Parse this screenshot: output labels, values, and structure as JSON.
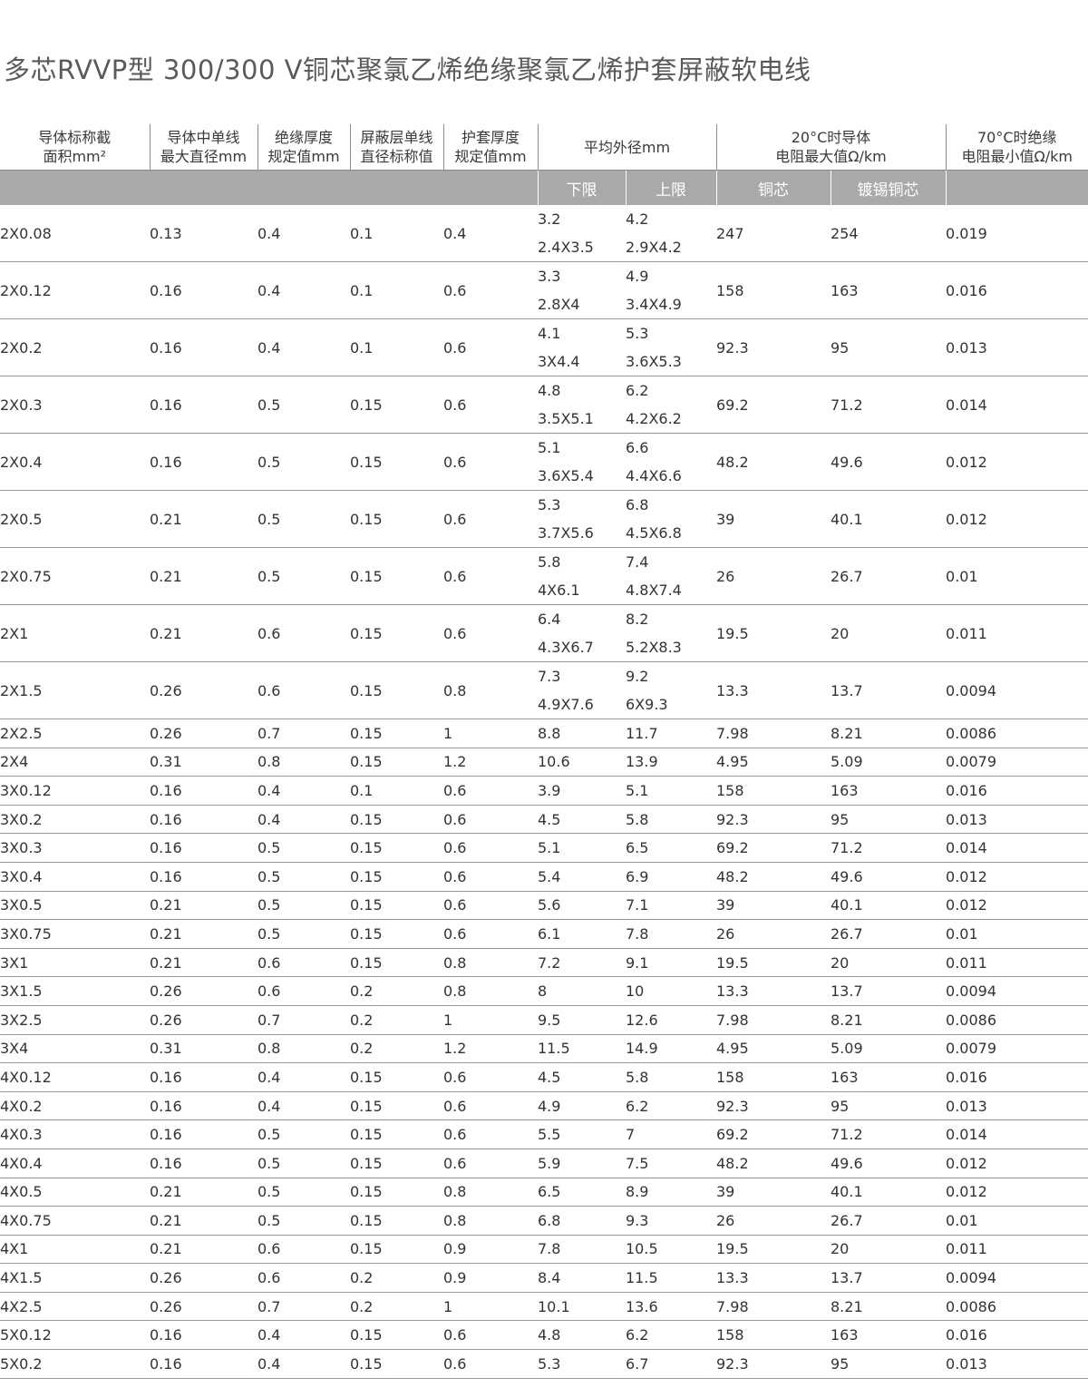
{
  "title": "多芯RVVP型 300/300 V铜芯聚氯乙烯绝缘聚氯乙烯护套屏蔽软电线",
  "headers": {
    "area_l1": "导体标称截",
    "area_l2": "面积mm²",
    "wire_l1": "导体中单线",
    "wire_l2": "最大直径mm",
    "insul_l1": "绝缘厚度",
    "insul_l2": "规定值mm",
    "shield_l1": "屏蔽层单线",
    "shield_l2": "直径标称值",
    "sheath_l1": "护套厚度",
    "sheath_l2": "规定值mm",
    "od": "平均外径mm",
    "res20_l1": "20°C时导体",
    "res20_l2": "电阻最大值Ω/km",
    "ins70_l1": "70°C时绝缘",
    "ins70_l2": "电阻最小值Ω/km",
    "lower": "下限",
    "upper": "上限",
    "copper": "铜芯",
    "tinned": "镀锡铜芯"
  },
  "rows": [
    {
      "area": "2X0.08",
      "wire": "0.13",
      "ins": "0.4",
      "shield": "0.1",
      "sheath": "0.4",
      "lo1": "3.2",
      "lo2": "2.4X3.5",
      "hi1": "4.2",
      "hi2": "2.9X4.2",
      "cu": "247",
      "sn": "254",
      "r70": "0.019"
    },
    {
      "area": "2X0.12",
      "wire": "0.16",
      "ins": "0.4",
      "shield": "0.1",
      "sheath": "0.6",
      "lo1": "3.3",
      "lo2": "2.8X4",
      "hi1": "4.9",
      "hi2": "3.4X4.9",
      "cu": "158",
      "sn": "163",
      "r70": "0.016"
    },
    {
      "area": "2X0.2",
      "wire": "0.16",
      "ins": "0.4",
      "shield": "0.1",
      "sheath": "0.6",
      "lo1": "4.1",
      "lo2": "3X4.4",
      "hi1": "5.3",
      "hi2": "3.6X5.3",
      "cu": "92.3",
      "sn": "95",
      "r70": "0.013"
    },
    {
      "area": "2X0.3",
      "wire": "0.16",
      "ins": "0.5",
      "shield": "0.15",
      "sheath": "0.6",
      "lo1": "4.8",
      "lo2": "3.5X5.1",
      "hi1": "6.2",
      "hi2": "4.2X6.2",
      "cu": "69.2",
      "sn": "71.2",
      "r70": "0.014"
    },
    {
      "area": "2X0.4",
      "wire": "0.16",
      "ins": "0.5",
      "shield": "0.15",
      "sheath": "0.6",
      "lo1": "5.1",
      "lo2": "3.6X5.4",
      "hi1": "6.6",
      "hi2": "4.4X6.6",
      "cu": "48.2",
      "sn": "49.6",
      "r70": "0.012"
    },
    {
      "area": "2X0.5",
      "wire": "0.21",
      "ins": "0.5",
      "shield": "0.15",
      "sheath": "0.6",
      "lo1": "5.3",
      "lo2": "3.7X5.6",
      "hi1": "6.8",
      "hi2": "4.5X6.8",
      "cu": "39",
      "sn": "40.1",
      "r70": "0.012"
    },
    {
      "area": "2X0.75",
      "wire": "0.21",
      "ins": "0.5",
      "shield": "0.15",
      "sheath": "0.6",
      "lo1": "5.8",
      "lo2": "4X6.1",
      "hi1": "7.4",
      "hi2": "4.8X7.4",
      "cu": "26",
      "sn": "26.7",
      "r70": "0.01"
    },
    {
      "area": "2X1",
      "wire": "0.21",
      "ins": "0.6",
      "shield": "0.15",
      "sheath": "0.6",
      "lo1": "6.4",
      "lo2": "4.3X6.7",
      "hi1": "8.2",
      "hi2": "5.2X8.3",
      "cu": "19.5",
      "sn": "20",
      "r70": "0.011"
    },
    {
      "area": "2X1.5",
      "wire": "0.26",
      "ins": "0.6",
      "shield": "0.15",
      "sheath": "0.8",
      "lo1": "7.3",
      "lo2": "4.9X7.6",
      "hi1": "9.2",
      "hi2": "6X9.3",
      "cu": "13.3",
      "sn": "13.7",
      "r70": "0.0094"
    },
    {
      "area": "2X2.5",
      "wire": "0.26",
      "ins": "0.7",
      "shield": "0.15",
      "sheath": "1",
      "lo1": "8.8",
      "hi1": "11.7",
      "cu": "7.98",
      "sn": "8.21",
      "r70": "0.0086"
    },
    {
      "area": "2X4",
      "wire": "0.31",
      "ins": "0.8",
      "shield": "0.15",
      "sheath": "1.2",
      "lo1": "10.6",
      "hi1": "13.9",
      "cu": "4.95",
      "sn": "5.09",
      "r70": "0.0079"
    },
    {
      "area": "3X0.12",
      "wire": "0.16",
      "ins": "0.4",
      "shield": "0.1",
      "sheath": "0.6",
      "lo1": "3.9",
      "hi1": "5.1",
      "cu": "158",
      "sn": "163",
      "r70": "0.016"
    },
    {
      "area": "3X0.2",
      "wire": "0.16",
      "ins": "0.4",
      "shield": "0.15",
      "sheath": "0.6",
      "lo1": "4.5",
      "hi1": "5.8",
      "cu": "92.3",
      "sn": "95",
      "r70": "0.013"
    },
    {
      "area": "3X0.3",
      "wire": "0.16",
      "ins": "0.5",
      "shield": "0.15",
      "sheath": "0.6",
      "lo1": "5.1",
      "hi1": "6.5",
      "cu": "69.2",
      "sn": "71.2",
      "r70": "0.014"
    },
    {
      "area": "3X0.4",
      "wire": "0.16",
      "ins": "0.5",
      "shield": "0.15",
      "sheath": "0.6",
      "lo1": "5.4",
      "hi1": "6.9",
      "cu": "48.2",
      "sn": "49.6",
      "r70": "0.012"
    },
    {
      "area": "3X0.5",
      "wire": "0.21",
      "ins": "0.5",
      "shield": "0.15",
      "sheath": "0.6",
      "lo1": "5.6",
      "hi1": "7.1",
      "cu": "39",
      "sn": "40.1",
      "r70": "0.012"
    },
    {
      "area": "3X0.75",
      "wire": "0.21",
      "ins": "0.5",
      "shield": "0.15",
      "sheath": "0.6",
      "lo1": "6.1",
      "hi1": "7.8",
      "cu": "26",
      "sn": "26.7",
      "r70": "0.01"
    },
    {
      "area": "3X1",
      "wire": "0.21",
      "ins": "0.6",
      "shield": "0.15",
      "sheath": "0.8",
      "lo1": "7.2",
      "hi1": "9.1",
      "cu": "19.5",
      "sn": "20",
      "r70": "0.011"
    },
    {
      "area": "3X1.5",
      "wire": "0.26",
      "ins": "0.6",
      "shield": "0.2",
      "sheath": "0.8",
      "lo1": "8",
      "hi1": "10",
      "cu": "13.3",
      "sn": "13.7",
      "r70": "0.0094"
    },
    {
      "area": "3X2.5",
      "wire": "0.26",
      "ins": "0.7",
      "shield": "0.2",
      "sheath": "1",
      "lo1": "9.5",
      "hi1": "12.6",
      "cu": "7.98",
      "sn": "8.21",
      "r70": "0.0086"
    },
    {
      "area": "3X4",
      "wire": "0.31",
      "ins": "0.8",
      "shield": "0.2",
      "sheath": "1.2",
      "lo1": "11.5",
      "hi1": "14.9",
      "cu": "4.95",
      "sn": "5.09",
      "r70": "0.0079"
    },
    {
      "area": "4X0.12",
      "wire": "0.16",
      "ins": "0.4",
      "shield": "0.15",
      "sheath": "0.6",
      "lo1": "4.5",
      "hi1": "5.8",
      "cu": "158",
      "sn": "163",
      "r70": "0.016"
    },
    {
      "area": "4X0.2",
      "wire": "0.16",
      "ins": "0.4",
      "shield": "0.15",
      "sheath": "0.6",
      "lo1": "4.9",
      "hi1": "6.2",
      "cu": "92.3",
      "sn": "95",
      "r70": "0.013"
    },
    {
      "area": "4X0.3",
      "wire": "0.16",
      "ins": "0.5",
      "shield": "0.15",
      "sheath": "0.6",
      "lo1": "5.5",
      "hi1": "7",
      "cu": "69.2",
      "sn": "71.2",
      "r70": "0.014"
    },
    {
      "area": "4X0.4",
      "wire": "0.16",
      "ins": "0.5",
      "shield": "0.15",
      "sheath": "0.6",
      "lo1": "5.9",
      "hi1": "7.5",
      "cu": "48.2",
      "sn": "49.6",
      "r70": "0.012"
    },
    {
      "area": "4X0.5",
      "wire": "0.21",
      "ins": "0.5",
      "shield": "0.15",
      "sheath": "0.8",
      "lo1": "6.5",
      "hi1": "8.9",
      "cu": "39",
      "sn": "40.1",
      "r70": "0.012"
    },
    {
      "area": "4X0.75",
      "wire": "0.21",
      "ins": "0.5",
      "shield": "0.15",
      "sheath": "0.8",
      "lo1": "6.8",
      "hi1": "9.3",
      "cu": "26",
      "sn": "26.7",
      "r70": "0.01"
    },
    {
      "area": "4X1",
      "wire": "0.21",
      "ins": "0.6",
      "shield": "0.15",
      "sheath": "0.9",
      "lo1": "7.8",
      "hi1": "10.5",
      "cu": "19.5",
      "sn": "20",
      "r70": "0.011"
    },
    {
      "area": "4X1.5",
      "wire": "0.26",
      "ins": "0.6",
      "shield": "0.2",
      "sheath": "0.9",
      "lo1": "8.4",
      "hi1": "11.5",
      "cu": "13.3",
      "sn": "13.7",
      "r70": "0.0094"
    },
    {
      "area": "4X2.5",
      "wire": "0.26",
      "ins": "0.7",
      "shield": "0.2",
      "sheath": "1",
      "lo1": "10.1",
      "hi1": "13.6",
      "cu": "7.98",
      "sn": "8.21",
      "r70": "0.0086"
    },
    {
      "area": "5X0.12",
      "wire": "0.16",
      "ins": "0.4",
      "shield": "0.15",
      "sheath": "0.6",
      "lo1": "4.8",
      "hi1": "6.2",
      "cu": "158",
      "sn": "163",
      "r70": "0.016"
    },
    {
      "area": "5X0.2",
      "wire": "0.16",
      "ins": "0.4",
      "shield": "0.15",
      "sheath": "0.6",
      "lo1": "5.3",
      "hi1": "6.7",
      "cu": "92.3",
      "sn": "95",
      "r70": "0.013"
    }
  ]
}
